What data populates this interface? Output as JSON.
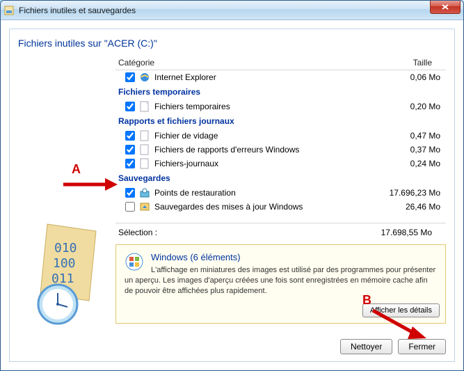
{
  "window": {
    "title": "Fichiers inutiles et sauvegardes"
  },
  "heading": "Fichiers inutiles sur \"ACER (C:)\"",
  "columns": {
    "category": "Catégorie",
    "size": "Taille"
  },
  "groups": [
    {
      "name": "top",
      "label": "",
      "items": [
        {
          "checked": true,
          "icon": "ie",
          "label": "Internet Explorer",
          "size": "0,06 Mo"
        }
      ]
    },
    {
      "name": "temp",
      "label": "Fichiers temporaires",
      "items": [
        {
          "checked": true,
          "icon": "file",
          "label": "Fichiers temporaires",
          "size": "0,20 Mo"
        }
      ]
    },
    {
      "name": "reports",
      "label": "Rapports et fichiers journaux",
      "items": [
        {
          "checked": true,
          "icon": "file",
          "label": "Fichier de vidage",
          "size": "0,47 Mo"
        },
        {
          "checked": true,
          "icon": "file",
          "label": "Fichiers de rapports d'erreurs Windows",
          "size": "0,37 Mo"
        },
        {
          "checked": true,
          "icon": "file",
          "label": "Fichiers-journaux",
          "size": "0,24 Mo"
        }
      ]
    },
    {
      "name": "backups",
      "label": "Sauvegardes",
      "items": [
        {
          "checked": true,
          "icon": "restore",
          "label": "Points de restauration",
          "size": "17.696,23 Mo"
        },
        {
          "checked": false,
          "icon": "update",
          "label": "Sauvegardes des mises à jour Windows",
          "size": "26,46 Mo"
        }
      ]
    }
  ],
  "selection": {
    "label": "Sélection :",
    "size": "17.698,55 Mo"
  },
  "info": {
    "title": "Windows (6 éléments)",
    "text": "L'affichage en miniatures des images est utilisé par des programmes pour présenter un aperçu. Les images d'aperçu créées une fois sont enregistrées en mémoire cache afin de pouvoir être affichées plus rapidement.",
    "details_btn": "Afficher les détails"
  },
  "buttons": {
    "clean": "Nettoyer",
    "close": "Fermer"
  },
  "annotations": {
    "a": "A",
    "b": "B"
  }
}
